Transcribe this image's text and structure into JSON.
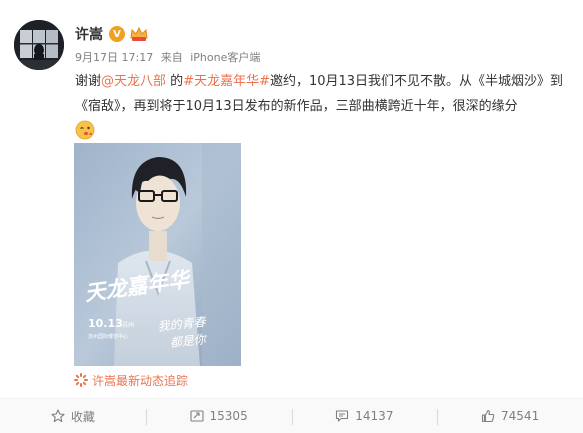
{
  "author": {
    "name": "许嵩",
    "verified_icon": "v-verified-icon",
    "vip_icon": "vip-crown-icon"
  },
  "meta": {
    "time": "9月17日 17:17",
    "source_prefix": "来自",
    "source": "iPhone客户端"
  },
  "post": {
    "t1": "谢谢",
    "mention": "@天龙八部",
    "t2": " 的",
    "hashtag": "#天龙嘉年华#",
    "t3": "邀约，10月13日我们不见不散。从《半城烟沙》到《宿敌》，再到将于10月13日发布的新作品，三部曲横跨近十年，很深的缘分",
    "emoji": "kiss-emoji-icon"
  },
  "image": {
    "poster_title": "天龙嘉年华",
    "date": "10.13",
    "date_suffix": "苏州",
    "venue": "苏州国际博览中心",
    "tagline_1": "我的青春",
    "tagline_2": "都是你"
  },
  "topic_link": "许嵩最新动态追踪",
  "actions": {
    "favorite": "收藏",
    "repost": "15305",
    "comment": "14137",
    "like": "74541"
  },
  "colors": {
    "link": "#eb7350",
    "badge": "#f2a020",
    "muted": "#808080"
  }
}
